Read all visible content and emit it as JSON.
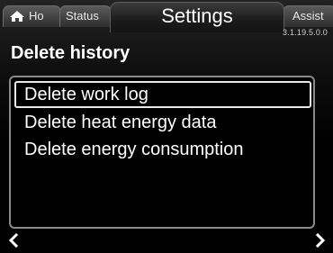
{
  "tabs": {
    "home": {
      "label": "Ho",
      "icon": "home-icon"
    },
    "status": {
      "label": "Status"
    },
    "active": {
      "label": "Settings"
    },
    "assist": {
      "label": "Assist"
    }
  },
  "version": "3.1.19.5.0.0",
  "page": {
    "title": "Delete history"
  },
  "list": {
    "items": [
      {
        "label": "Delete work log",
        "selected": true
      },
      {
        "label": "Delete heat energy data",
        "selected": false
      },
      {
        "label": "Delete energy consumption",
        "selected": false
      }
    ]
  },
  "nav": {
    "prev_icon": "chevron-left-icon",
    "next_icon": "chevron-right-icon"
  }
}
